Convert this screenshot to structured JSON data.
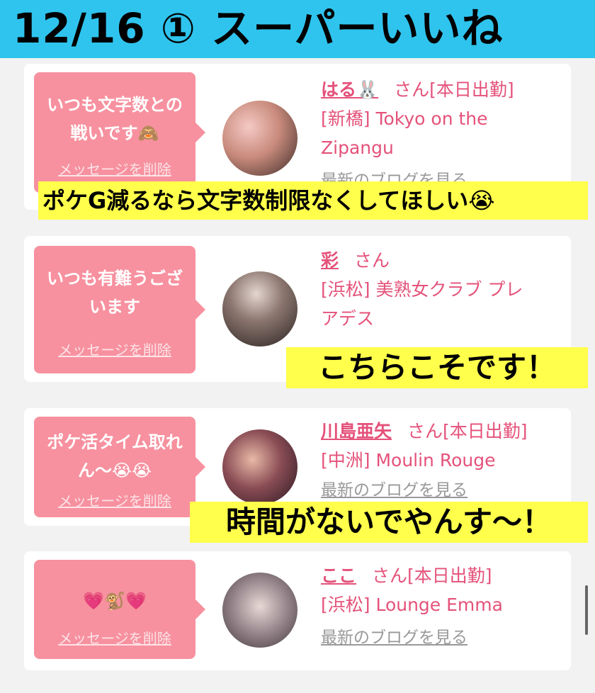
{
  "title": "12/16 ① スーパーいいね",
  "delete_label": "メッセージを削除",
  "san_label": "さん",
  "blog_label": "最新のブログを見る",
  "cards": [
    {
      "message": "いつも文字数との\n戦いです🙈",
      "name": "はる🐰",
      "status": "[本日出勤]",
      "shop_line1": "[新橋] Tokyo on the",
      "shop_line2": "Zipangu"
    },
    {
      "message": "いつも有難うござ\nいます",
      "name": "彩",
      "status": "",
      "shop_line1": "[浜松] 美熟女クラブ プレ",
      "shop_line2": "アデス"
    },
    {
      "message": "ポケ活タイム取れ\nん〜😭😭",
      "name": "川島亜矢",
      "status": "[本日出勤]",
      "shop_line1": "[中洲] Moulin Rouge",
      "shop_line2": ""
    },
    {
      "message": "💗🐒💗",
      "name": "ここ",
      "status": "[本日出勤]",
      "shop_line1": "[浜松] Lounge Emma",
      "shop_line2": ""
    }
  ],
  "captions": [
    "ポケG減るなら文字数制限なくしてほしい😭",
    "こちらこそです！",
    "時間がないでやんす〜！"
  ],
  "colors": {
    "title_bg": "#2fc4ee",
    "bubble": "#f7919f",
    "accent_text": "#e4527a",
    "caption_bg": "#ffff4c"
  }
}
